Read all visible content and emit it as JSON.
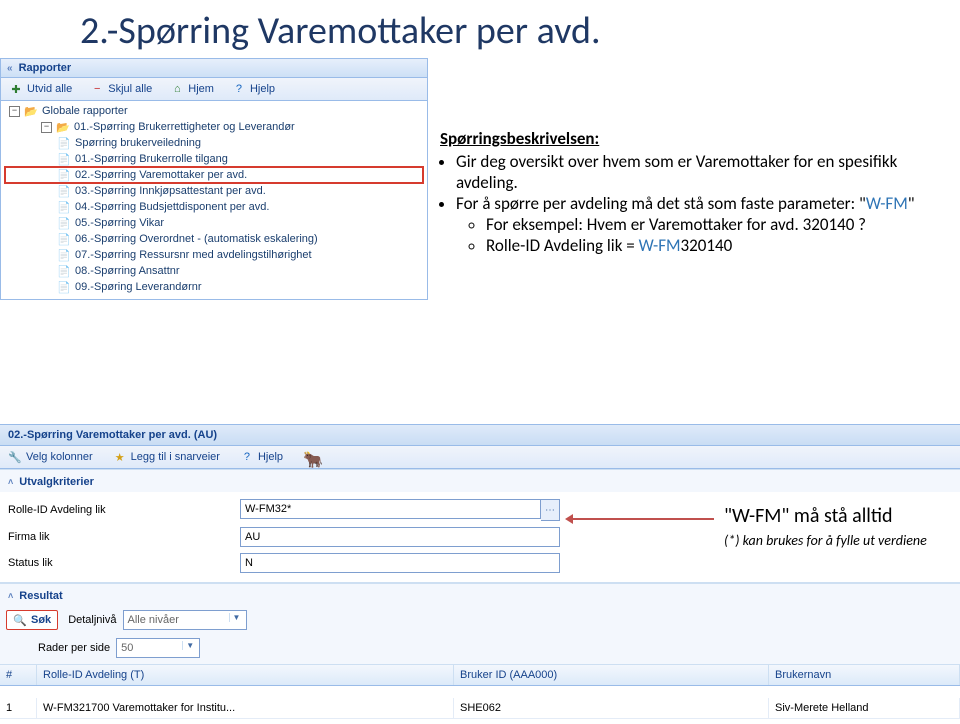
{
  "slide": {
    "title": "2.-Spørring Varemottaker per avd."
  },
  "rapporter_panel": {
    "title": "Rapporter",
    "toolbar": {
      "expand_all": "Utvid alle",
      "collapse_all": "Skjul alle",
      "home": "Hjem",
      "help": "Hjelp"
    },
    "tree": {
      "root": "Globale rapporter",
      "parent": "01.-Spørring Brukerrettigheter og Leverandør",
      "children": [
        "Spørring brukerveiledning",
        "01.-Spørring Brukerrolle tilgang",
        "02.-Spørring Varemottaker per avd.",
        "03.-Spørring Innkjøpsattestant per avd.",
        "04.-Spørring Budsjettdisponent per avd.",
        "05.-Spørring Vikar",
        "06.-Spørring Overordnet - (automatisk eskalering)",
        "07.-Spørring Ressursnr med avdelingstilhørighet",
        "08.-Spørring Ansattnr",
        "09.-Spøring Leverandørnr"
      ]
    }
  },
  "description": {
    "heading": "Spørringsbeskrivelsen:",
    "line1": "Gir deg oversikt over hvem som er Varemottaker for en spesifikk avdeling.",
    "line2_a": "For å spørre per avdeling må det stå som faste parameter: \"",
    "line2_b": "W-FM",
    "line2_c": "\"",
    "line3": "For eksempel:  Hvem er Varemottaker for avd. 320140 ?",
    "line4_a": "Rolle-ID Avdeling lik = ",
    "line4_b": "W-FM",
    "line4_c": "320140"
  },
  "bottom_panel": {
    "title": "02.-Spørring Varemottaker per avd. (AU)",
    "toolbar": {
      "velg_kolonner": "Velg kolonner",
      "legg_til": "Legg til i snarveier",
      "hjelp": "Hjelp"
    },
    "utvalg": {
      "section": "Utvalgkriterier",
      "rows": [
        {
          "label": "Rolle-ID Avdeling lik",
          "value": "W-FM32*",
          "picker": true
        },
        {
          "label": "Firma lik",
          "value": "AU",
          "picker": false
        },
        {
          "label": "Status lik",
          "value": "N",
          "picker": false
        }
      ]
    },
    "annotation": {
      "must": "\"W-FM\" må stå alltid",
      "hint": "(*) kan brukes for å fylle ut  verdiene"
    },
    "resultat": {
      "section": "Resultat",
      "sok": "Søk",
      "detaljniva": "Detaljnivå",
      "detaljniva_val": "Alle nivåer",
      "rader_label": "Rader per side",
      "rader_val": "50",
      "columns": {
        "num": "#",
        "rolle": "Rolle-ID Avdeling (T)",
        "bruker": "Bruker ID (AAA000)",
        "navn": "Brukernavn"
      },
      "rows": [
        {
          "num": "1",
          "rolle": "W-FM321700 Varemottaker for Institu...",
          "bruker": "SHE062",
          "navn": "Siv-Merete Helland"
        }
      ]
    }
  }
}
